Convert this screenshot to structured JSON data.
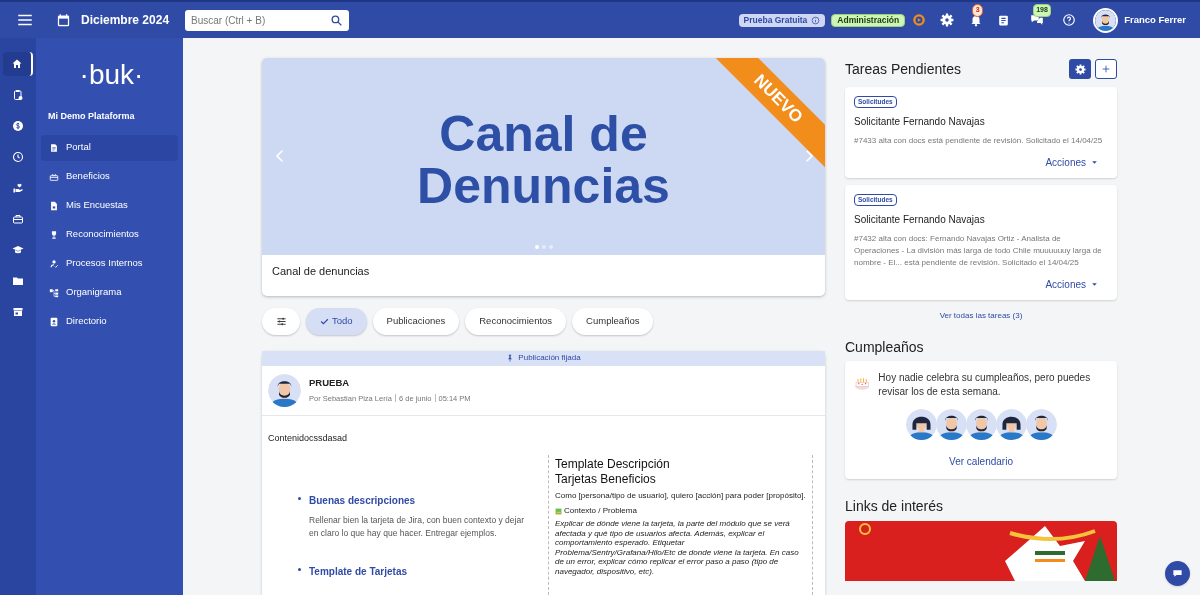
{
  "topbar": {
    "month": "Diciembre 2024",
    "search": {
      "placeholder": "Buscar (Ctrl + B)"
    },
    "trial": "Prueba Gratuita",
    "role": "Administración",
    "notifications": "3",
    "messages": "198",
    "user": "Franco Ferrer"
  },
  "rail": [
    {
      "selected": true
    },
    {
      "selected": false
    },
    {
      "selected": false
    },
    {
      "selected": false
    },
    {
      "selected": false
    },
    {
      "selected": false
    },
    {
      "selected": false
    },
    {
      "selected": false
    },
    {
      "selected": false
    }
  ],
  "sidebar": {
    "logo": "·buk·",
    "company": "Mi Demo Plataforma",
    "items": [
      {
        "label": "Portal",
        "selected": true
      },
      {
        "label": "Beneficios",
        "selected": false
      },
      {
        "label": "Mis Encuestas",
        "selected": false
      },
      {
        "label": "Reconocimientos",
        "selected": false
      },
      {
        "label": "Procesos Internos",
        "selected": false
      },
      {
        "label": "Organigrama",
        "selected": false
      },
      {
        "label": "Directorio",
        "selected": false
      }
    ]
  },
  "banner": {
    "title": "Canal de Denuncias",
    "ribbon": "NUEVO",
    "caption": "Canal de denuncias",
    "dots": [
      {
        "selected": true
      },
      {
        "selected": false
      },
      {
        "selected": false
      }
    ]
  },
  "filters": [
    {
      "label": "Todo",
      "selected": true
    },
    {
      "label": "Publicaciones",
      "selected": false
    },
    {
      "label": "Reconocimientos",
      "selected": false
    },
    {
      "label": "Cumpleaños",
      "selected": false
    }
  ],
  "post": {
    "pinned": "Publicación fijada",
    "title": "PRUEBA",
    "author": "Por Sebastian Piza Lería",
    "date": "6 de junio",
    "time": "05:14 PM",
    "content": "Contenidocssdasad",
    "document": {
      "bullets": [
        {
          "heading": "Buenas descripciones",
          "text": "Rellenar bien la tarjeta de Jira, con buen contexto y dejar en claro lo que hay que hacer. Entregar ejemplos."
        },
        {
          "heading": "Template de Tarjetas"
        }
      ],
      "page_title": "Template Descripción Tarjetas Beneficios",
      "intro": "Como [persona/tipo de usuario], quiero [acción] para poder [propósito].",
      "section": "Contexto / Problema",
      "body": "Explicar de dónde viene la tarjeta, la parte del módulo que se verá afectada y qué tipo de usuarios afecta. Además, explicar el comportamiento esperado. Etiquetar Problema/Sentry/Grafana/Hilo/Etc de donde viene la tarjeta. En caso de un error, explicar cómo replicar el error paso a paso (tipo de navegador, dispositivo, etc)."
    }
  },
  "tasks": {
    "title": "Tareas Pendientes",
    "items": [
      {
        "tag": "Solicitudes",
        "title": "Solicitante Fernando Navajas",
        "description": "#7433 alta con docs está pendiente de revisión. Solicitado el 14/04/25",
        "action": "Acciones"
      },
      {
        "tag": "Solicitudes",
        "title": "Solicitante Fernando Navajas",
        "description": "#7432 alta con docs: Fernando Navajas Ortiz - Analista de Operaciones - La división más larga de todo Chile muuuuuuy larga de nombre - El... está pendiente de revisión. Solicitado el 14/04/25",
        "action": "Acciones"
      }
    ],
    "link": "Ver todas las tareas (3)"
  },
  "birthdays": {
    "title": "Cumpleaños",
    "message": "Hoy nadie celebra su cumpleaños, pero puedes revisar los de esta semana.",
    "people": [
      {
        "kind": "woman"
      },
      {
        "kind": "man"
      },
      {
        "kind": "man"
      },
      {
        "kind": "woman"
      },
      {
        "kind": "man"
      }
    ],
    "link": "Ver calendario"
  },
  "links": {
    "title": "Links de interés"
  }
}
